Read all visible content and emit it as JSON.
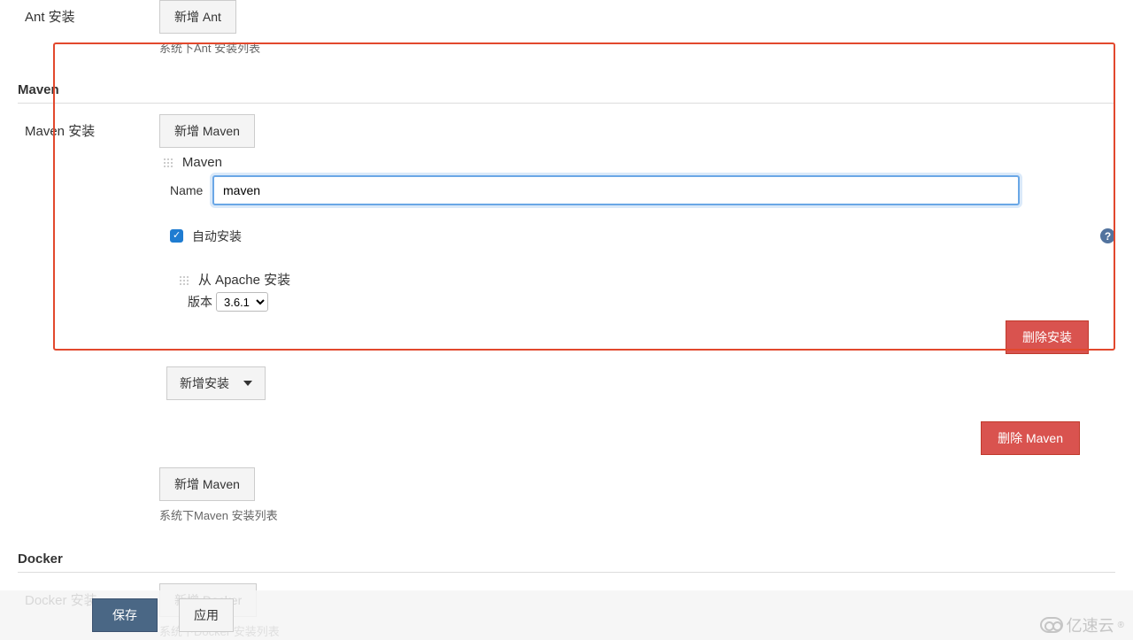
{
  "ant": {
    "label": "Ant 安装",
    "add_button": "新增 Ant",
    "desc": "系统下Ant 安装列表"
  },
  "maven": {
    "section_title": "Maven",
    "label": "Maven 安装",
    "add_button_top": "新增 Maven",
    "installation_title": "Maven",
    "name_label": "Name",
    "name_value": "maven",
    "auto_install_label": "自动安装",
    "auto_install_checked": true,
    "installer_title": "从 Apache 安装",
    "version_label": "版本",
    "version_value": "3.6.1",
    "delete_installer": "删除安装",
    "add_installer": "新增安装",
    "delete_maven": "删除 Maven",
    "add_button_bottom": "新增 Maven",
    "desc": "系统下Maven 安装列表"
  },
  "docker": {
    "section_title": "Docker",
    "label": "Docker 安装",
    "add_button": "新增 Docker",
    "desc": "系统下Docker 安装列表"
  },
  "footer": {
    "save": "保存",
    "apply": "应用"
  },
  "watermark": "亿速云"
}
